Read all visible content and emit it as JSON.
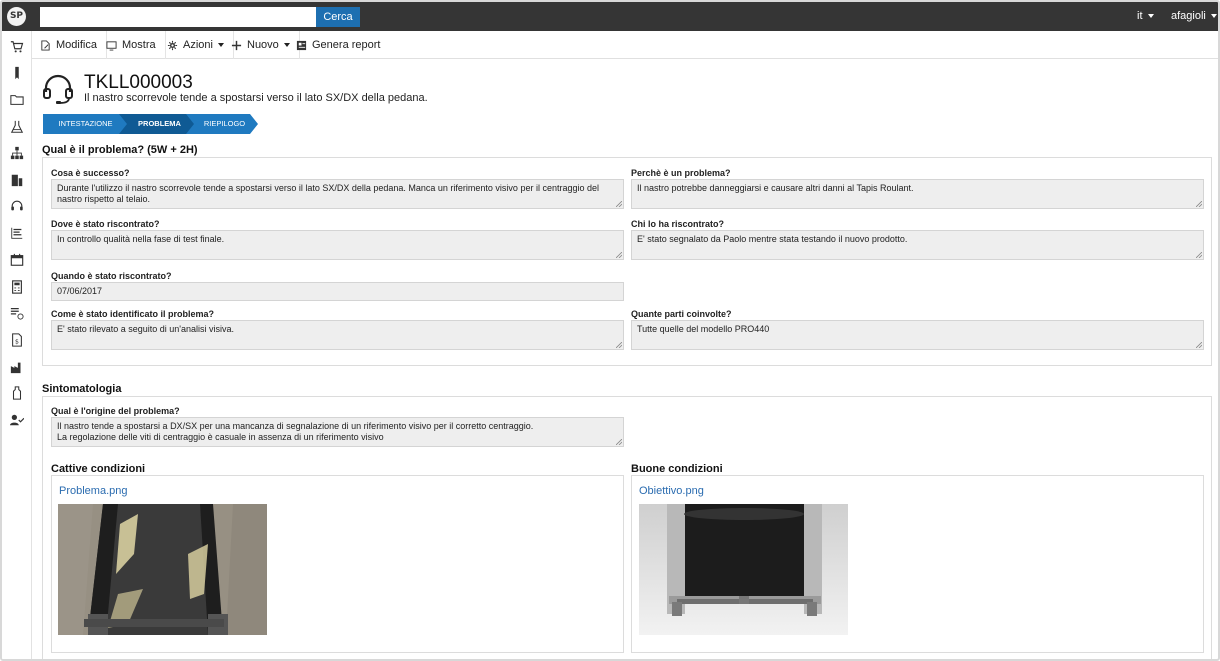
{
  "topbar": {
    "logo_text": "SP",
    "search_placeholder": "",
    "search_button": "Cerca",
    "language": "it",
    "username": "afagioli"
  },
  "toolbar": {
    "edit": "Modifica",
    "show": "Mostra",
    "actions": "Azioni",
    "new": "Nuovo",
    "report": "Genera report"
  },
  "ticket": {
    "code": "TKLL000003",
    "description": "Il nastro scorrevole tende a spostarsi verso il lato SX/DX della pedana."
  },
  "steps": [
    {
      "label": "INTESTAZIONE",
      "active": false
    },
    {
      "label": "PROBLEMA",
      "active": true
    },
    {
      "label": "RIEPILOGO",
      "active": false
    }
  ],
  "problem_section": {
    "title": "Qual è il problema? (5W + 2H)",
    "what_label": "Cosa è successo?",
    "what_value": "Durante l'utilizzo il nastro scorrevole tende a spostarsi verso il lato SX/DX della pedana. Manca un riferimento visivo per il centraggio del nastro rispetto al telaio.",
    "why_label": "Perchè è un problema?",
    "why_value": "Il nastro potrebbe danneggiarsi e causare altri danni al Tapis Roulant.",
    "where_label": "Dove è stato riscontrato?",
    "where_value": "In controllo qualità nella fase di test finale.",
    "who_label": "Chi lo ha riscontrato?",
    "who_value": "E' stato segnalato da Paolo mentre stata testando il nuovo prodotto.",
    "when_label": "Quando è stato riscontrato?",
    "when_value": "07/06/2017",
    "how_label": "Come è stato identificato il problema?",
    "how_value": "E' stato rilevato a seguito di un'analisi visiva.",
    "howmany_label": "Quante parti coinvolte?",
    "howmany_value": "Tutte quelle del modello PRO440"
  },
  "symptoms_section": {
    "title": "Sintomatologia",
    "origin_label": "Qual è l'origine del problema?",
    "origin_line1": "Il nastro tende a spostarsi a DX/SX per una mancanza di segnalazione di un riferimento visivo per il corretto centraggio.",
    "origin_line2": "La regolazione delle viti di centraggio è casuale in assenza di un riferimento visivo",
    "bad_title": "Cattive condizioni",
    "bad_file": "Problema.png",
    "good_title": "Buone condizioni",
    "good_file": "Obiettivo.png"
  },
  "colors": {
    "accent": "#1d6fb1",
    "topbar": "#353535",
    "step_active": "#0f5a94",
    "step_inactive": "#1f7ac0"
  }
}
